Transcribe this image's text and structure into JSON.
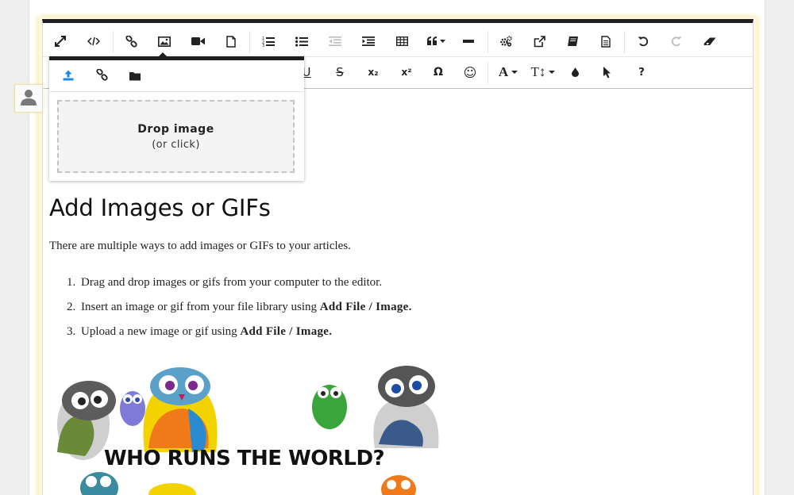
{
  "toolbar": {
    "row1": [
      {
        "name": "fullscreen-icon",
        "label": "Fullscreen"
      },
      {
        "name": "code-view-icon",
        "label": "Code View"
      },
      {
        "name": "link-icon",
        "label": "Insert Link"
      },
      {
        "name": "image-icon",
        "label": "Insert Image"
      },
      {
        "name": "video-icon",
        "label": "Insert Video"
      },
      {
        "name": "file-icon",
        "label": "Insert File"
      },
      {
        "name": "ordered-list-icon",
        "label": "Ordered List"
      },
      {
        "name": "unordered-list-icon",
        "label": "Unordered List"
      },
      {
        "name": "outdent-icon",
        "label": "Decrease Indent",
        "disabled": true
      },
      {
        "name": "indent-icon",
        "label": "Increase Indent"
      },
      {
        "name": "table-icon",
        "label": "Insert Table"
      },
      {
        "name": "quote-icon",
        "label": "Quote"
      },
      {
        "name": "horizontal-line-icon",
        "label": "Insert Horizontal Line"
      },
      {
        "name": "settings-icon",
        "label": "Settings"
      },
      {
        "name": "external-link-icon",
        "label": "Open Link"
      },
      {
        "name": "book-icon",
        "label": "Glossary"
      },
      {
        "name": "document-icon",
        "label": "Template"
      },
      {
        "name": "undo-icon",
        "label": "Undo"
      },
      {
        "name": "redo-icon",
        "label": "Redo",
        "disabled": true
      },
      {
        "name": "eraser-icon",
        "label": "Clear Formatting"
      }
    ],
    "row2_labels": {
      "underline": "U",
      "strikethrough": "S",
      "subscript": "x₂",
      "superscript": "x²",
      "special_chars": "Ω",
      "emoticons": "☺",
      "font_color": "A",
      "font_size": "T↕",
      "help": "?"
    }
  },
  "image_popup": {
    "tabs": [
      {
        "name": "upload-icon",
        "label": "Upload Image",
        "active": true
      },
      {
        "name": "link-icon",
        "label": "By URL"
      },
      {
        "name": "folder-icon",
        "label": "Image Manager"
      }
    ],
    "drop_title": "Drop image",
    "drop_subtitle": "(or click)"
  },
  "article": {
    "title": "Add Images or GIFs",
    "intro": "There are multiple ways to add images or GIFs to your articles.",
    "steps": [
      {
        "num": "1.",
        "text": "Drag and drop images or gifs from your computer to the editor.",
        "bold": ""
      },
      {
        "num": "2.",
        "text": "Insert an image or gif from your file library using ",
        "bold": "Add File / Image."
      },
      {
        "num": "3.",
        "text": "Upload a new image or gif using ",
        "bold": "Add File / Image."
      }
    ],
    "image_caption": "WHO RUNS THE WORLD?"
  },
  "colors": {
    "accent_blue": "#1e88e5",
    "toolbar_border": "#1f1f21",
    "highlight_glow": "#f8efbf"
  }
}
